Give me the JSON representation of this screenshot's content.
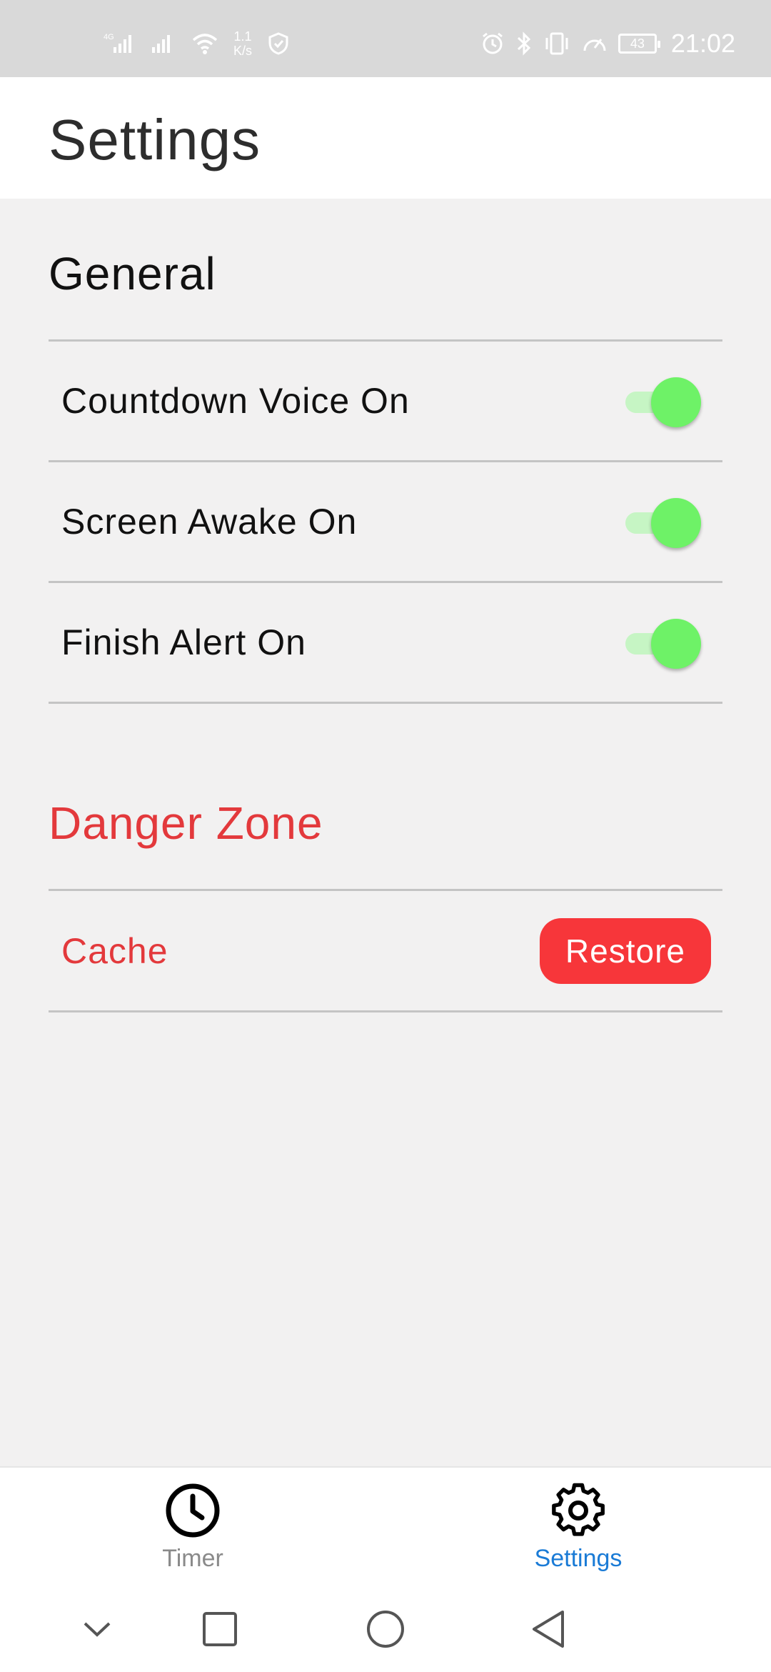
{
  "status_bar": {
    "net_speed_value": "1.1",
    "net_speed_unit": "K/s",
    "battery": "43",
    "time": "21:02",
    "icons_left": [
      "signal-4g-icon",
      "signal-icon",
      "wifi-icon",
      "shield-icon"
    ],
    "icons_right": [
      "alarm-icon",
      "bluetooth-icon",
      "vibrate-icon",
      "speed-icon",
      "battery-icon"
    ]
  },
  "header": {
    "title": "Settings"
  },
  "general": {
    "title": "General",
    "items": [
      {
        "label": "Countdown Voice On",
        "enabled": true
      },
      {
        "label": "Screen Awake On",
        "enabled": true
      },
      {
        "label": "Finish Alert On",
        "enabled": true
      }
    ]
  },
  "danger_zone": {
    "title": "Danger Zone",
    "cache_label": "Cache",
    "restore_label": "Restore"
  },
  "tabs": [
    {
      "label": "Timer",
      "icon": "clock-icon",
      "active": false
    },
    {
      "label": "Settings",
      "icon": "gear-icon",
      "active": true
    }
  ],
  "colors": {
    "accent_danger": "#f7363a",
    "danger_text": "#e3393c",
    "toggle_on": "#6ef267",
    "tab_active": "#1a7bd6"
  }
}
